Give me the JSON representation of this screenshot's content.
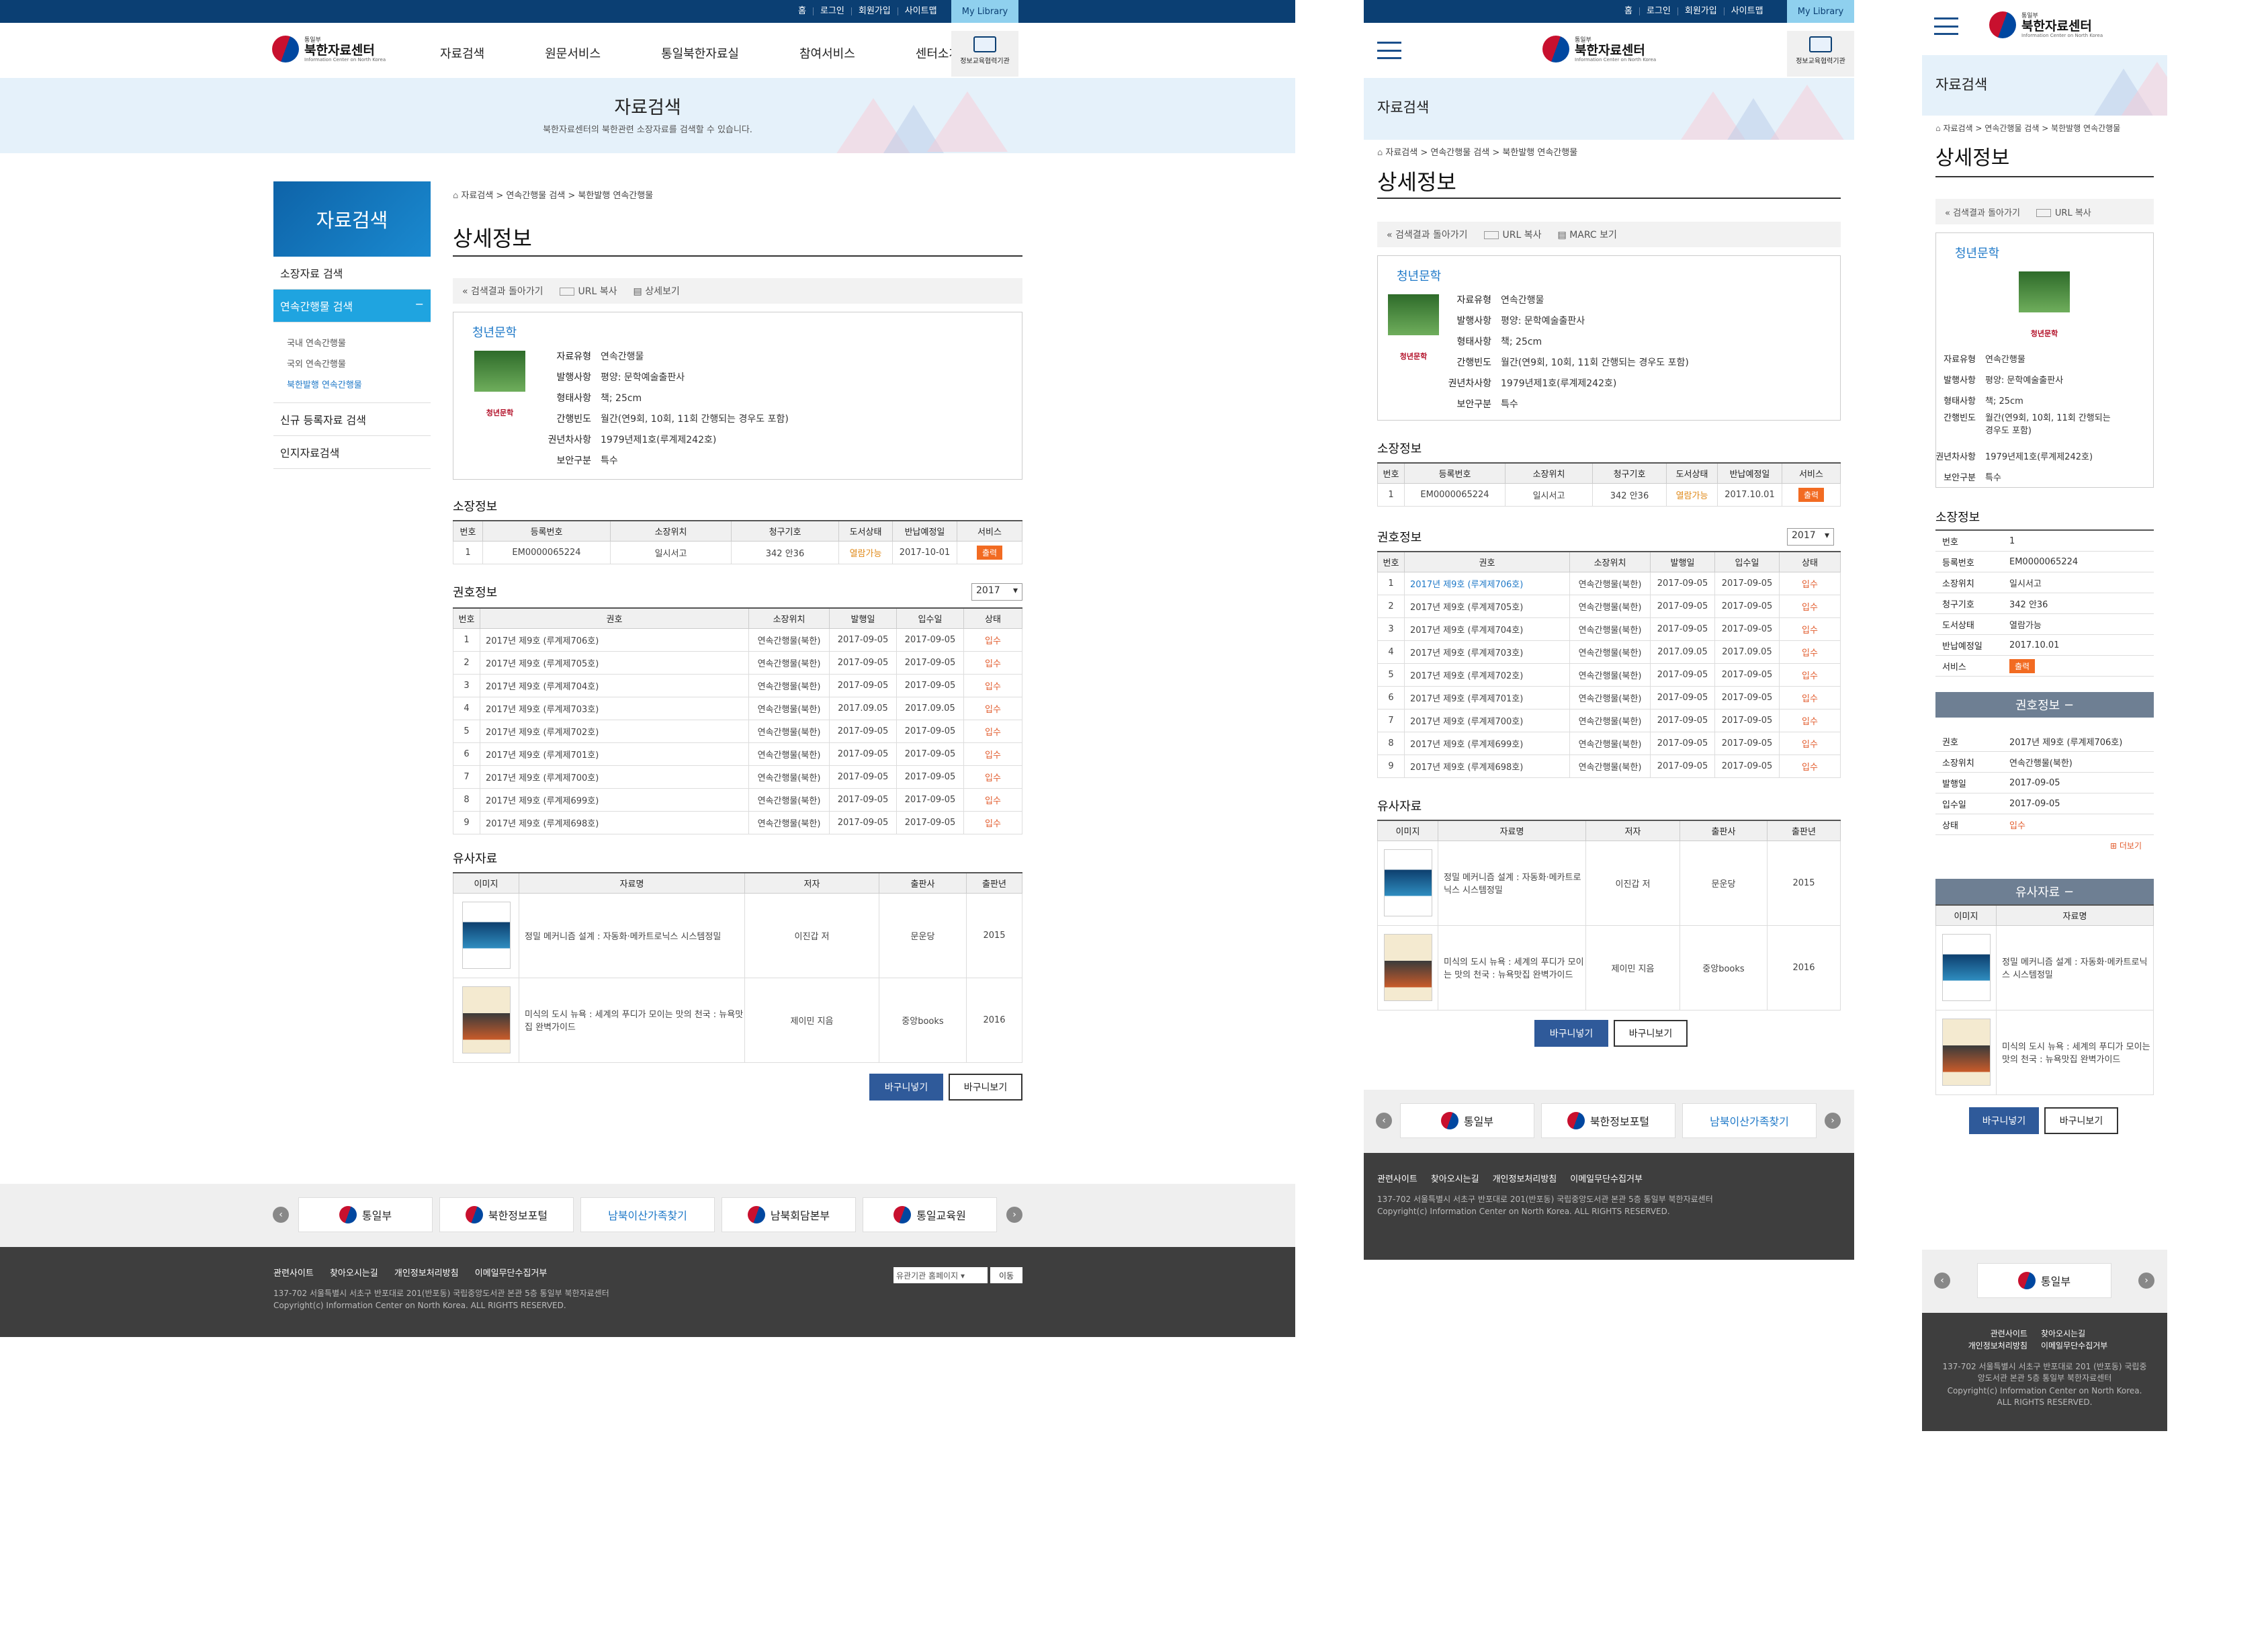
{
  "top": {
    "links": [
      "홈",
      "로그인",
      "회원가입",
      "사이트맵"
    ],
    "mylib": "My Library"
  },
  "logo": {
    "small": "통일부",
    "name": "북한자료센터",
    "en": "Information Center on North Korea"
  },
  "gnb": [
    "자료검색",
    "원문서비스",
    "통일북한자료실",
    "참여서비스",
    "센터소개"
  ],
  "edu": "정보교육협력기관",
  "visual": {
    "title": "자료검색",
    "desc": "북한자료센터의 북한관련 소장자료를 검색할 수 있습니다."
  },
  "lnb": {
    "head": "자료검색",
    "items": [
      "소장자료 검색",
      "연속간행물 검색",
      "신규 등록자료 검색",
      "인지자료검색"
    ],
    "minus": "−",
    "subs": [
      "국내 연속간행물",
      "국외 연속간행물",
      "북한발행 연속간행물"
    ]
  },
  "crumb": "자료검색 > 연속간행물 검색 > 북한발행 연속간행물",
  "page_title": "상세정보",
  "tools": {
    "back": "검색결과 돌아가기",
    "url": "URL 복사",
    "detail": "상세보기",
    "marc": "MARC 보기"
  },
  "book": {
    "title": "청년문학",
    "fields": [
      {
        "k": "자료유형",
        "v": "연속간행물"
      },
      {
        "k": "발행사항",
        "v": "평양: 문학예술출판사"
      },
      {
        "k": "형태사항",
        "v": "책; 25cm"
      },
      {
        "k": "간행빈도",
        "v": "월간(연9회, 10회, 11회 간행되는 경우도 포함)"
      },
      {
        "k": "권년차사항",
        "v": "1979년제1호(루계제242호)"
      },
      {
        "k": "보안구분",
        "v": "특수"
      }
    ]
  },
  "holding": {
    "title": "소장정보",
    "headers": [
      "번호",
      "등록번호",
      "소장위치",
      "청구기호",
      "도서상태",
      "반납예정일",
      "서비스"
    ],
    "row": {
      "no": "1",
      "reg": "EM0000065224",
      "loc": "일시서고",
      "call": "342 안36",
      "status": "열람가능",
      "due": "2017-10-01",
      "due_tab": "2017.10.01",
      "service": "출력"
    }
  },
  "volumes": {
    "title": "권호정보",
    "year": "2017",
    "headers": [
      "번호",
      "권호",
      "소장위치",
      "발행일",
      "입수일",
      "상태"
    ],
    "rows": [
      {
        "no": "1",
        "vol": "2017년 제9호 (루계제706호)",
        "loc": "연속간행물(북한)",
        "pub": "2017-09-05",
        "rcv": "2017-09-05",
        "st": "입수"
      },
      {
        "no": "2",
        "vol": "2017년 제9호 (루계제705호)",
        "loc": "연속간행물(북한)",
        "pub": "2017-09-05",
        "rcv": "2017-09-05",
        "st": "입수"
      },
      {
        "no": "3",
        "vol": "2017년 제9호 (루계제704호)",
        "loc": "연속간행물(북한)",
        "pub": "2017-09-05",
        "rcv": "2017-09-05",
        "st": "입수"
      },
      {
        "no": "4",
        "vol": "2017년 제9호 (루계제703호)",
        "loc": "연속간행물(북한)",
        "pub": "2017.09.05",
        "rcv": "2017.09.05",
        "st": "입수"
      },
      {
        "no": "5",
        "vol": "2017년 제9호 (루계제702호)",
        "loc": "연속간행물(북한)",
        "pub": "2017-09-05",
        "rcv": "2017-09-05",
        "st": "입수"
      },
      {
        "no": "6",
        "vol": "2017년 제9호 (루계제701호)",
        "loc": "연속간행물(북한)",
        "pub": "2017-09-05",
        "rcv": "2017-09-05",
        "st": "입수"
      },
      {
        "no": "7",
        "vol": "2017년 제9호 (루계제700호)",
        "loc": "연속간행물(북한)",
        "pub": "2017-09-05",
        "rcv": "2017-09-05",
        "st": "입수"
      },
      {
        "no": "8",
        "vol": "2017년 제9호 (루계제699호)",
        "loc": "연속간행물(북한)",
        "pub": "2017-09-05",
        "rcv": "2017-09-05",
        "st": "입수"
      },
      {
        "no": "9",
        "vol": "2017년 제9호 (루계제698호)",
        "loc": "연속간행물(북한)",
        "pub": "2017-09-05",
        "rcv": "2017-09-05",
        "st": "입수"
      }
    ]
  },
  "similar": {
    "title": "유사자료",
    "headers": [
      "이미지",
      "자료명",
      "저자",
      "출판사",
      "출판년"
    ],
    "rows": [
      {
        "name": "정밀 메커니즘 설계 : 자동화·메카트로닉스 시스템정밀",
        "author": "이진갑 저",
        "pub": "문운당",
        "year": "2015"
      },
      {
        "name": "미식의 도시 뉴욕 : 세계의 푸디가 모이는 맛의 천국 : 뉴욕맛집 완벽가이드",
        "author": "제이민 지음",
        "pub": "중앙books",
        "year": "2016"
      }
    ]
  },
  "buttons": {
    "cart": "바구니넣기",
    "view": "바구니보기"
  },
  "banners": [
    "통일부",
    "북한정보포털",
    "남북이산가족찾기",
    "남북회담본부",
    "통일교육원"
  ],
  "footer": {
    "links": [
      "관련사이트",
      "찾아오시는길",
      "개인정보처리방침",
      "이메일무단수집거부"
    ],
    "addr": "137-702 서울특별시 서초구 반포대로 201(반포동) 국립중앙도서관 본관 5층 통일부 북한자료센터",
    "copy": "Copyright(c) Information Center on North Korea. ALL RIGHTS RESERVED.",
    "select": "유관기관 홈페이지",
    "go": "이동"
  },
  "mobile": {
    "title": "자료검색",
    "vol_bar": "권호정보",
    "sim_bar": "유사자료",
    "more": "더보기",
    "minus": "−",
    "vol_fields": [
      {
        "k": "권호",
        "v": "2017년 제9호 (루계제706호)"
      },
      {
        "k": "소장위치",
        "v": "연속간행물(북한)"
      },
      {
        "k": "발행일",
        "v": "2017-09-05"
      },
      {
        "k": "입수일",
        "v": "2017-09-05"
      },
      {
        "k": "상태",
        "v": "입수"
      }
    ],
    "holding_keys": [
      "번호",
      "등록번호",
      "소장위치",
      "청구기호",
      "도서상태",
      "반납예정일",
      "서비스"
    ],
    "holding_vals": [
      "1",
      "EM0000065224",
      "일시서고",
      "342 안36",
      "열람가능",
      "2017.10.01",
      "출력"
    ],
    "foot": [
      "관련사이트",
      "찾아오시는길",
      "개인정보처리방침",
      "이메일무단수집거부"
    ],
    "addr": "137-702 서울특별시 서초구 반포대로 201 (반포동) 국립중앙도서관 본관 5층 통일부 북한자료센터",
    "copy": "Copyright(c) Information Center on North Korea. ALL RIGHTS RESERVED."
  }
}
